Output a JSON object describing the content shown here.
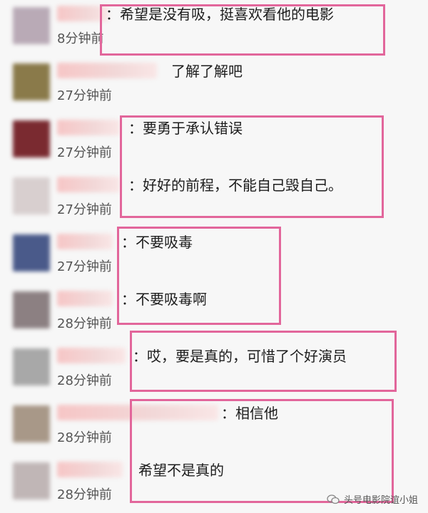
{
  "comments": [
    {
      "text": "：希望是没有吸，挺喜欢看他的电影",
      "time": "8分钟前",
      "avatar_color": "#b9aab6"
    },
    {
      "text": "了解了解吧",
      "time": "27分钟前",
      "avatar_color": "#8a7a4a"
    },
    {
      "text": "：要勇于承认错误",
      "time": "27分钟前",
      "avatar_color": "#7a2a30"
    },
    {
      "text": "：好好的前程，不能自己毁自己。",
      "time": "27分钟前",
      "avatar_color": "#d8cfcf"
    },
    {
      "text": "：不要吸毒",
      "time": "27分钟前",
      "avatar_color": "#4a5a8a"
    },
    {
      "text": "：不要吸毒啊",
      "time": "28分钟前",
      "avatar_color": "#8c8082"
    },
    {
      "text": "：哎，要是真的，可惜了个好演员",
      "time": "28分钟前",
      "avatar_color": "#a8a8a8"
    },
    {
      "text": "：相信他",
      "time": "28分钟前",
      "avatar_color": "#a89888"
    },
    {
      "text": "希望不是真的",
      "time": "28分钟前",
      "avatar_color": "#c0b6b6"
    }
  ],
  "watermark": {
    "text": "头号电影院谊小姐",
    "icon": "wechat-icon"
  },
  "colors": {
    "highlight_border": "#e2669b",
    "username_blur": "#f6c6c6"
  }
}
